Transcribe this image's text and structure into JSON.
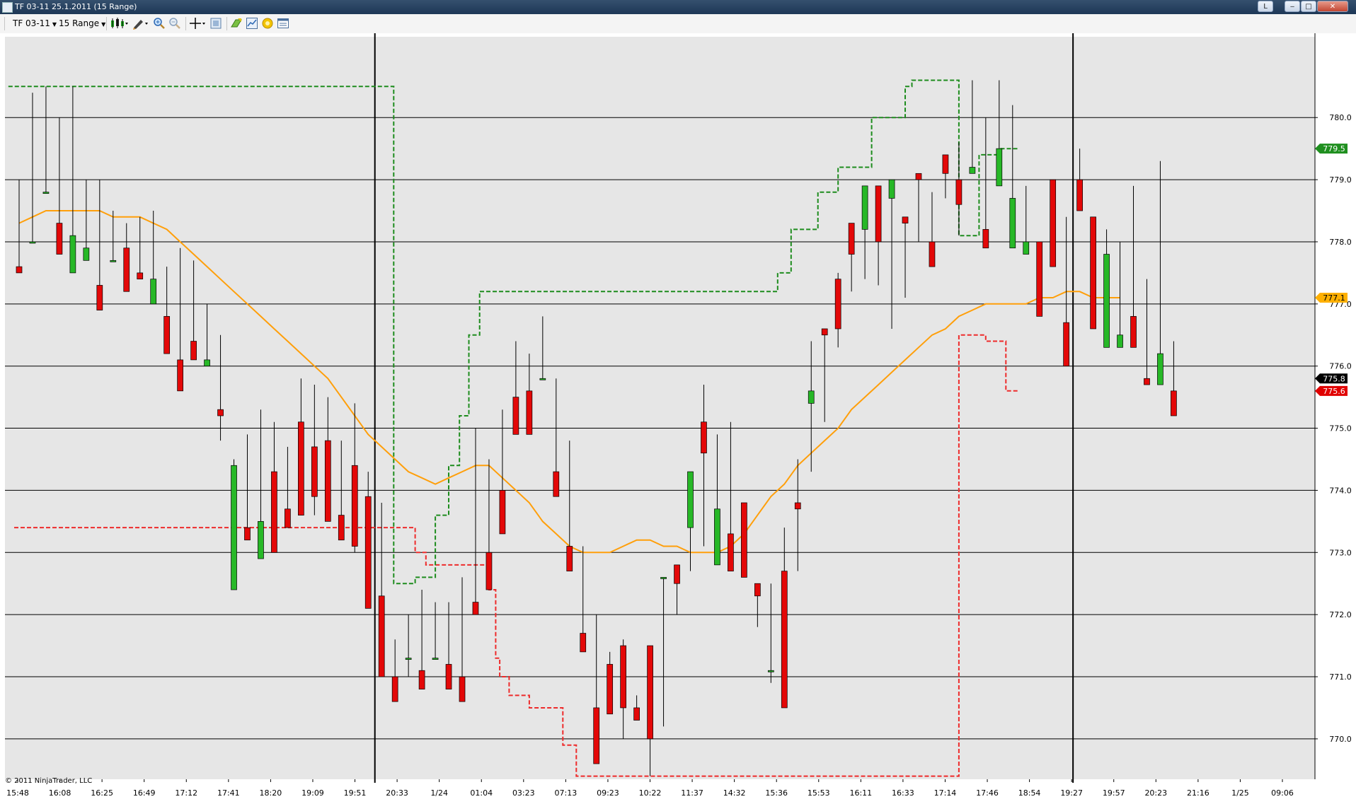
{
  "window": {
    "title": "TF 03-11  25.1.2011 (15 Range)",
    "btn_l": "L",
    "btn_min": "‒",
    "btn_max": "□",
    "btn_close": "✕"
  },
  "toolbar": {
    "instrument": "TF 03-11",
    "period": "15 Range",
    "icons": [
      "candlestick-icon",
      "pencil-icon",
      "zoom-in-icon",
      "zoom-out-icon",
      "crosshair-icon",
      "data-box-icon",
      "strategy-icon",
      "chart-trader-icon",
      "alert-icon",
      "properties-icon"
    ]
  },
  "chart_data": {
    "type": "candlestick",
    "ylim": [
      769.35,
      781.3
    ],
    "ytick_labels": [
      "770.0",
      "771.0",
      "772.0",
      "773.0",
      "774.0",
      "775.0",
      "776.0",
      "777.0",
      "778.0",
      "779.0",
      "780.0"
    ],
    "xtick_labels": [
      "15:48",
      "16:08",
      "16:25",
      "16:49",
      "17:12",
      "17:41",
      "18:20",
      "19:09",
      "19:51",
      "20:33",
      "1/24",
      "01:04",
      "03:23",
      "07:13",
      "09:23",
      "10:22",
      "11:37",
      "14:32",
      "15:36",
      "15:53",
      "16:11",
      "16:33",
      "17:14",
      "17:46",
      "18:54",
      "19:27",
      "19:57",
      "20:23",
      "21:16",
      "1/25",
      "09:06"
    ],
    "bullish_color": "#27b827",
    "bearish_color": "#e30808",
    "session_break_labels": [
      "1/24",
      "1/25"
    ],
    "candles": [
      [
        779.0,
        779.0,
        778.8,
        777.6,
        777.5
      ],
      [
        779.0,
        780.0,
        780.4,
        778.0,
        778.0
      ],
      [
        780.2,
        779.0,
        780.5,
        778.8,
        778.8
      ],
      [
        780.0,
        779.0,
        780.0,
        778.3,
        777.8
      ],
      [
        779.2,
        778.0,
        780.5,
        777.5,
        778.1
      ],
      [
        778.3,
        779.0,
        779.0,
        777.7,
        777.9
      ],
      [
        778.2,
        779.0,
        779.0,
        777.3,
        776.9
      ],
      [
        778.4,
        777.9,
        778.5,
        777.7,
        777.7
      ],
      [
        778.3,
        778.0,
        778.2,
        777.9,
        777.2
      ],
      [
        778.3,
        777.8,
        778.4,
        777.5,
        777.4
      ],
      [
        778.5,
        777.7,
        778.5,
        777.0,
        777.4
      ],
      [
        777.5,
        776.6,
        777.6,
        776.8,
        776.2
      ],
      [
        777.9,
        776.1,
        777.9,
        776.1,
        775.6
      ],
      [
        777.6,
        776.3,
        777.7,
        776.4,
        776.1
      ],
      [
        777.0,
        776.5,
        777.0,
        776.0,
        776.1
      ],
      [
        775.1,
        776.5,
        774.8,
        775.3,
        775.2
      ],
      [
        774.0,
        772.5,
        774.5,
        772.4,
        774.4
      ],
      [
        774.9,
        773.6,
        774.9,
        773.4,
        773.2
      ],
      [
        775.1,
        775.3,
        775.0,
        772.9,
        773.5
      ],
      [
        775.1,
        773.8,
        774.8,
        774.3,
        773.0
      ],
      [
        774.7,
        773.4,
        774.5,
        773.7,
        773.4
      ],
      [
        775.3,
        773.8,
        775.8,
        775.1,
        773.6
      ],
      [
        775.1,
        773.6,
        775.7,
        774.7,
        773.9
      ],
      [
        775.1,
        774.7,
        775.5,
        774.8,
        773.5
      ],
      [
        774.2,
        773.6,
        774.8,
        773.6,
        773.2
      ],
      [
        774.1,
        773.0,
        775.4,
        774.4,
        773.1
      ],
      [
        774.0,
        772.6,
        774.3,
        773.9,
        772.1
      ],
      [
        773.5,
        771.6,
        773.8,
        772.3,
        771.0
      ],
      [
        771.1,
        771.6,
        770.7,
        771.0,
        770.6
      ],
      [
        771.3,
        772.0,
        771.0,
        771.3,
        771.3
      ],
      [
        772.4,
        770.8,
        771.8,
        771.1,
        770.8
      ],
      [
        772.2,
        771.6,
        772.2,
        771.3,
        771.3
      ],
      [
        772.0,
        771.4,
        772.2,
        771.2,
        770.8
      ],
      [
        772.6,
        771.8,
        772.6,
        771.0,
        770.6
      ],
      [
        773.2,
        773.0,
        775.0,
        772.2,
        772.0
      ],
      [
        774.0,
        774.0,
        774.5,
        773.0,
        772.4
      ],
      [
        774.4,
        774.5,
        775.3,
        774.0,
        773.3
      ],
      [
        775.8,
        775.5,
        776.4,
        775.5,
        774.9
      ],
      [
        775.6,
        776.2,
        776.0,
        775.6,
        774.9
      ],
      [
        776.6,
        776.3,
        776.8,
        775.8,
        775.8
      ],
      [
        775.7,
        774.5,
        775.8,
        774.3,
        773.9
      ],
      [
        774.8,
        773.7,
        774.6,
        773.1,
        772.7
      ],
      [
        773.1,
        772.0,
        772.9,
        771.7,
        771.4
      ],
      [
        772.0,
        771.1,
        770.7,
        770.5,
        769.6
      ],
      [
        771.0,
        770.5,
        771.4,
        771.2,
        770.4
      ],
      [
        771.3,
        770.0,
        771.6,
        771.5,
        770.5
      ],
      [
        770.5,
        770.6,
        770.7,
        770.5,
        770.3
      ],
      [
        770.5,
        769.4,
        771.0,
        771.5,
        770.0
      ],
      [
        772.4,
        770.2,
        772.3,
        772.6,
        772.6
      ],
      [
        772.3,
        772.0,
        772.5,
        772.8,
        772.5
      ],
      [
        773.6,
        773.3,
        772.7,
        773.4,
        774.3
      ],
      [
        773.1,
        774.0,
        775.7,
        775.1,
        774.6
      ],
      [
        774.4,
        773.5,
        774.9,
        772.8,
        773.7
      ],
      [
        774.9,
        774.9,
        775.1,
        773.3,
        772.7
      ],
      [
        773.0,
        773.7,
        773.1,
        773.8,
        772.6
      ],
      [
        772.0,
        771.8,
        772.0,
        772.5,
        772.3
      ],
      [
        772.5,
        770.9,
        771.8,
        771.1,
        771.1
      ],
      [
        773.4,
        773.1,
        772.9,
        772.7,
        770.5
      ],
      [
        774.5,
        772.7,
        774.3,
        773.8,
        773.7
      ],
      [
        774.3,
        775.0,
        776.4,
        775.4,
        775.6
      ],
      [
        775.9,
        775.1,
        776.3,
        776.6,
        776.5
      ],
      [
        776.3,
        777.5,
        776.6,
        777.4,
        776.6
      ],
      [
        777.8,
        777.2,
        777.2,
        778.3,
        777.8
      ],
      [
        777.4,
        777.8,
        778.0,
        778.2,
        778.9
      ],
      [
        777.3,
        778.8,
        778.5,
        778.9,
        778.0
      ],
      [
        777.1,
        777.9,
        776.6,
        778.7,
        779.0
      ],
      [
        777.1,
        778.2,
        777.6,
        778.4,
        778.3
      ],
      [
        778.0,
        779.0,
        778.7,
        779.1,
        779.0
      ],
      [
        778.0,
        778.8,
        778.8,
        778.0,
        777.6
      ],
      [
        778.7,
        779.2,
        779.3,
        779.4,
        779.1
      ],
      [
        778.1,
        779.6,
        778.3,
        779.0,
        778.6
      ],
      [
        780.6,
        780.4,
        780.1,
        779.1,
        779.2
      ],
      [
        780.0,
        779.7,
        778.5,
        778.2,
        777.9
      ],
      [
        780.6,
        779.9,
        779.5,
        778.9,
        779.5
      ],
      [
        780.2,
        778.5,
        779.0,
        777.9,
        778.7
      ],
      [
        778.9,
        778.7,
        778.8,
        777.8,
        778.0
      ],
      [
        777.5,
        777.8,
        778.0,
        778.0,
        776.8
      ],
      [
        777.9,
        778.4,
        777.7,
        779.0,
        777.6
      ],
      [
        778.4,
        777.7,
        778.0,
        776.7,
        776.0
      ],
      [
        779.2,
        779.5,
        778.7,
        779.0,
        778.5
      ],
      [
        778.2,
        777.9,
        777.4,
        778.4,
        776.6
      ],
      [
        778.2,
        778.1,
        777.8,
        776.3,
        777.8
      ],
      [
        778.0,
        777.2,
        777.4,
        776.3,
        776.5
      ],
      [
        778.6,
        778.9,
        777.2,
        776.8,
        776.3
      ],
      [
        777.4,
        776.4,
        775.8,
        775.8,
        775.7
      ],
      [
        779.3,
        778.4,
        776.6,
        775.7,
        776.2
      ],
      [
        776.4,
        775.6,
        776.0,
        775.6,
        775.2
      ]
    ],
    "ema_points": [
      [
        0,
        778.3
      ],
      [
        1,
        778.4
      ],
      [
        2,
        778.5
      ],
      [
        3,
        778.5
      ],
      [
        4,
        778.5
      ],
      [
        5,
        778.5
      ],
      [
        6,
        778.5
      ],
      [
        7,
        778.4
      ],
      [
        8,
        778.4
      ],
      [
        9,
        778.4
      ],
      [
        10,
        778.3
      ],
      [
        11,
        778.2
      ],
      [
        12,
        778.0
      ],
      [
        13,
        777.8
      ],
      [
        14,
        777.6
      ],
      [
        15,
        777.4
      ],
      [
        16,
        777.2
      ],
      [
        17,
        777.0
      ],
      [
        18,
        776.8
      ],
      [
        19,
        776.6
      ],
      [
        20,
        776.4
      ],
      [
        21,
        776.2
      ],
      [
        22,
        776.0
      ],
      [
        23,
        775.8
      ],
      [
        24,
        775.5
      ],
      [
        25,
        775.2
      ],
      [
        26,
        774.9
      ],
      [
        27,
        774.7
      ],
      [
        28,
        774.5
      ],
      [
        29,
        774.3
      ],
      [
        30,
        774.2
      ],
      [
        31,
        774.1
      ],
      [
        32,
        774.2
      ],
      [
        33,
        774.3
      ],
      [
        34,
        774.4
      ],
      [
        35,
        774.4
      ],
      [
        36,
        774.2
      ],
      [
        37,
        774.0
      ],
      [
        38,
        773.8
      ],
      [
        39,
        773.5
      ],
      [
        40,
        773.3
      ],
      [
        41,
        773.1
      ],
      [
        42,
        773.0
      ],
      [
        43,
        773.0
      ],
      [
        44,
        773.0
      ],
      [
        45,
        773.1
      ],
      [
        46,
        773.2
      ],
      [
        47,
        773.2
      ],
      [
        48,
        773.1
      ],
      [
        49,
        773.1
      ],
      [
        50,
        773.0
      ],
      [
        51,
        773.0
      ],
      [
        52,
        773.0
      ],
      [
        53,
        773.1
      ],
      [
        54,
        773.3
      ],
      [
        55,
        773.6
      ],
      [
        56,
        773.9
      ],
      [
        57,
        774.1
      ],
      [
        58,
        774.4
      ],
      [
        59,
        774.6
      ],
      [
        60,
        774.8
      ],
      [
        61,
        775.0
      ],
      [
        62,
        775.3
      ],
      [
        63,
        775.5
      ],
      [
        64,
        775.7
      ],
      [
        65,
        775.9
      ],
      [
        66,
        776.1
      ],
      [
        67,
        776.3
      ],
      [
        68,
        776.5
      ],
      [
        69,
        776.6
      ],
      [
        70,
        776.8
      ],
      [
        71,
        776.9
      ],
      [
        72,
        777.0
      ],
      [
        73,
        777.0
      ],
      [
        74,
        777.0
      ],
      [
        75,
        777.0
      ],
      [
        76,
        777.1
      ],
      [
        77,
        777.1
      ],
      [
        78,
        777.2
      ],
      [
        79,
        777.2
      ],
      [
        80,
        777.1
      ],
      [
        81,
        777.1
      ],
      [
        82,
        777.1
      ]
    ],
    "upper_band": [
      [
        -0.8,
        780.5
      ],
      [
        1.4,
        780.5
      ],
      [
        1.4,
        772.5
      ],
      [
        3,
        772.5
      ],
      [
        3,
        772.6
      ],
      [
        4.5,
        772.6
      ],
      [
        4.5,
        773.6
      ],
      [
        5.5,
        773.6
      ],
      [
        5.5,
        774.4
      ],
      [
        6.3,
        774.4
      ],
      [
        6.3,
        775.2
      ],
      [
        7,
        775.2
      ],
      [
        7,
        776.5
      ],
      [
        7.8,
        776.5
      ],
      [
        7.8,
        777.2
      ],
      [
        30,
        777.2
      ],
      [
        30,
        777.5
      ],
      [
        31,
        777.5
      ],
      [
        31,
        778.2
      ],
      [
        33,
        778.2
      ],
      [
        33,
        778.8
      ],
      [
        34.5,
        778.8
      ],
      [
        34.5,
        779.2
      ],
      [
        37,
        779.2
      ],
      [
        37,
        780.0
      ],
      [
        39.5,
        780.0
      ],
      [
        39.5,
        780.5
      ],
      [
        40,
        780.5
      ],
      [
        40,
        780.6
      ],
      [
        43.5,
        780.6
      ],
      [
        43.5,
        778.1
      ],
      [
        45,
        778.1
      ],
      [
        45,
        779.4
      ],
      [
        46.5,
        779.4
      ],
      [
        46.5,
        779.5
      ],
      [
        48,
        779.5
      ]
    ],
    "lower_band": [
      [
        -8,
        773.4
      ],
      [
        3,
        773.4
      ],
      [
        3,
        773.0
      ],
      [
        3.8,
        773.0
      ],
      [
        3.8,
        772.8
      ],
      [
        8.5,
        772.8
      ],
      [
        8.5,
        772.4
      ],
      [
        9,
        772.4
      ],
      [
        9,
        771.3
      ],
      [
        9.3,
        771.3
      ],
      [
        9.3,
        771.0
      ],
      [
        10,
        771.0
      ],
      [
        10,
        770.7
      ],
      [
        11.5,
        770.7
      ],
      [
        11.5,
        770.5
      ],
      [
        14,
        770.5
      ],
      [
        14,
        769.9
      ],
      [
        15,
        769.9
      ],
      [
        15,
        769.4
      ],
      [
        43.5,
        769.4
      ],
      [
        43.5,
        776.5
      ],
      [
        45.5,
        776.5
      ],
      [
        45.5,
        776.4
      ],
      [
        47,
        776.4
      ],
      [
        47,
        775.6
      ],
      [
        48,
        775.6
      ]
    ],
    "price_markers": [
      {
        "value": "779.5",
        "price": 779.5,
        "bg": "#1f8f1f",
        "fg": "#ffffff"
      },
      {
        "value": "777.1",
        "price": 777.1,
        "bg": "#ffb000",
        "fg": "#000000"
      },
      {
        "value": "775.8",
        "price": 775.8,
        "bg": "#000000",
        "fg": "#ffffff"
      },
      {
        "value": "775.6",
        "price": 775.6,
        "bg": "#e00000",
        "fg": "#ffffff"
      }
    ],
    "copyright": "© 2011 NinjaTrader, LLC"
  }
}
